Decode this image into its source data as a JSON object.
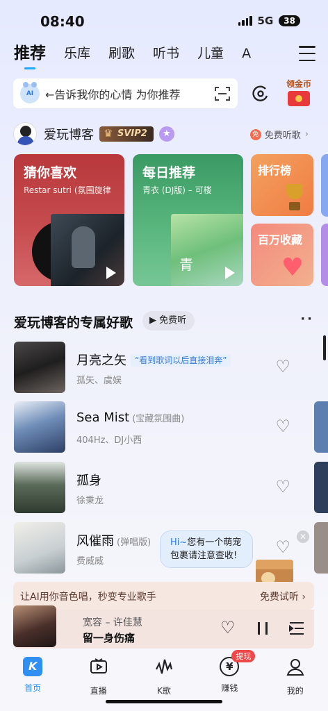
{
  "status": {
    "time": "08:40",
    "network": "5G",
    "battery": "38"
  },
  "tabs": [
    "推荐",
    "乐库",
    "刷歌",
    "听书",
    "儿童",
    "A"
  ],
  "search": {
    "placeholder": "←告诉我你的心情 为你推荐",
    "mascot_label": "AI"
  },
  "gold": {
    "label": "领金币"
  },
  "user": {
    "name": "爱玩博客",
    "vip": "SVIP2",
    "free_listen": "免费听歌"
  },
  "cards": {
    "guess": {
      "title": "猜你喜欢",
      "subtitle": "Restar sutri (氛围旋律"
    },
    "daily": {
      "title": "每日推荐",
      "subtitle": "青衣 (DJ版) – 可楼",
      "cover_text": "青"
    },
    "rank": {
      "title": "排行榜"
    },
    "million": {
      "title": "百万收藏"
    }
  },
  "section": {
    "title": "爱玩博客的专属好歌",
    "free_pill": "▶ 免费听"
  },
  "songs": [
    {
      "title": "月亮之矢",
      "tag": "",
      "quote": "“看到歌词以后直接泪奔”",
      "artist": "孤矢、虞娱"
    },
    {
      "title": "Sea Mist",
      "tag": "(宝藏氛围曲)",
      "quote": "",
      "artist": "404Hz、DJ小西"
    },
    {
      "title": "孤身",
      "tag": "",
      "quote": "",
      "artist": "徐秉龙"
    },
    {
      "title": "风催雨",
      "tag": "(弹唱版)",
      "quote": "",
      "artist": "费威威"
    }
  ],
  "bubble": {
    "hi": "Hi~",
    "line1": "您有一个萌宠",
    "line2": "包裹请注意查收!"
  },
  "ai_banner": {
    "left": "让AI用你音色唱，秒变专业歌手",
    "right": "免费试听 ›"
  },
  "player": {
    "song": "宽容 – 许佳慧",
    "line": "留一身伤痛"
  },
  "nav": [
    {
      "label": "首页",
      "icon": "K"
    },
    {
      "label": "直播",
      "icon": ""
    },
    {
      "label": "K歌",
      "icon": ""
    },
    {
      "label": "赚钱",
      "icon": "¥",
      "badge": "提现"
    },
    {
      "label": "我的",
      "icon": ""
    }
  ],
  "colors": {
    "accent": "#1fa8f7",
    "nav_active": "#1f8ef0",
    "guess": "#b8383b",
    "daily": "#3a9a63",
    "rank": "#f07c43"
  }
}
